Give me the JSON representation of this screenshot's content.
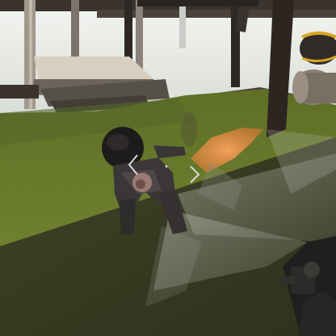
{
  "scene": {
    "type": "first-person game view",
    "description_ui": {},
    "colors": {
      "sky_fog": "#e9ece8",
      "grass": "#6a7b2c",
      "shadow_ground": "#3a3d22",
      "wood_dark": "#2f2a25",
      "wood_light": "#9a8f82",
      "character_cloth": "#3a3636",
      "barrel_accent": "#d9a623",
      "flash_orange": "#e98a42",
      "reticle": "#d8d8d8"
    },
    "icons": {
      "reticle": "target-reticle-icon",
      "weapon": "weapon-viewmodel",
      "barrel": "barrel-prop"
    }
  }
}
